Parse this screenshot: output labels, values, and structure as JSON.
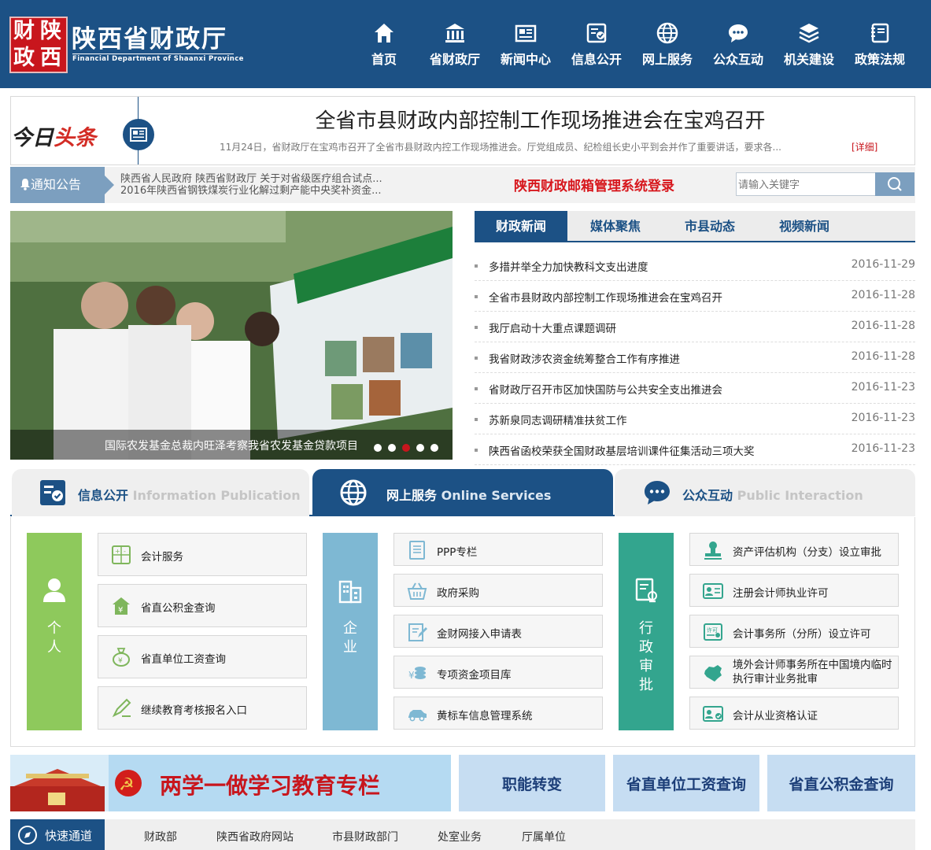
{
  "logo": {
    "seal_chars": [
      "财",
      "陕",
      "政",
      "西"
    ],
    "title": "陕西省财政厅",
    "subtitle": "Financial Department of Shaanxi Province"
  },
  "nav": [
    {
      "label": "首页",
      "icon": "home-icon"
    },
    {
      "label": "省财政厅",
      "icon": "building-icon"
    },
    {
      "label": "新闻中心",
      "icon": "newspaper-icon"
    },
    {
      "label": "信息公开",
      "icon": "document-check-icon"
    },
    {
      "label": "网上服务",
      "icon": "globe-icon"
    },
    {
      "label": "公众互动",
      "icon": "chat-icon"
    },
    {
      "label": "机关建设",
      "icon": "layers-icon"
    },
    {
      "label": "政策法规",
      "icon": "book-icon"
    }
  ],
  "headline": {
    "label_a": "今日",
    "label_b": "头条",
    "title": "全省市县财政内部控制工作现场推进会在宝鸡召开",
    "summary": "11月24日，省财政厅在宝鸡市召开了全省市县财政内控工作现场推进会。厅党组成员、纪检组长史小平到会并作了重要讲话，要求各...",
    "more": "[详细]"
  },
  "notice": {
    "label": "通知公告",
    "items": [
      "陕西省人民政府 陕西省财政厅 关于对省级医疗组合试点...",
      "2016年陕西省钢铁煤炭行业化解过剩产能中央奖补资金..."
    ]
  },
  "mail_login": "陕西财政邮箱管理系统登录",
  "search": {
    "placeholder": "请输入关键字"
  },
  "slider": {
    "caption": "国际农发基金总裁内旺泽考察我省农发基金贷款项目",
    "dots": 5,
    "active_dot": 3
  },
  "news_tabs": [
    "财政新闻",
    "媒体聚焦",
    "市县动态",
    "视频新闻"
  ],
  "news_active_tab": 0,
  "news": [
    {
      "title": "多措并举全力加快教科文支出进度",
      "date": "2016-11-29"
    },
    {
      "title": "全省市县财政内部控制工作现场推进会在宝鸡召开",
      "date": "2016-11-28"
    },
    {
      "title": "我厅启动十大重点课题调研",
      "date": "2016-11-28"
    },
    {
      "title": "我省财政涉农资金统筹整合工作有序推进",
      "date": "2016-11-28"
    },
    {
      "title": "省财政厅召开市区加快国防与公共安全支出推进会",
      "date": "2016-11-23"
    },
    {
      "title": "苏新泉同志调研精准扶贫工作",
      "date": "2016-11-23"
    },
    {
      "title": "陕西省函校荣获全国财政基层培训课件征集活动三项大奖",
      "date": "2016-11-23"
    }
  ],
  "svc_tabs": [
    {
      "cn": "信息公开",
      "en": "Information Publication"
    },
    {
      "cn": "网上服务",
      "en": "Online Services"
    },
    {
      "cn": "公众互动",
      "en": "Public Interaction"
    }
  ],
  "svc_active_tab": 1,
  "categories": [
    {
      "chars": [
        "个",
        "人"
      ],
      "color": "#8ec95c"
    },
    {
      "chars": [
        "企",
        "业"
      ],
      "color": "#7eb8d3"
    },
    {
      "chars": [
        "行",
        "政",
        "审",
        "批"
      ],
      "color": "#33a58e"
    }
  ],
  "personal": [
    "会计服务",
    "省直公积金查询",
    "省直单位工资查询",
    "继续教育考核报名入口"
  ],
  "enterprise": [
    "PPP专栏",
    "政府采购",
    "金财网接入申请表",
    "专项资金项目库",
    "黄标车信息管理系统"
  ],
  "admin": [
    "资产评估机构（分支）设立审批",
    "注册会计师执业许可",
    "会计事务所（分所）设立许可",
    "境外会计师事务所在中国境内临时执行审计业务批审",
    "会计从业资格认证"
  ],
  "banners": {
    "study": "两学一做学习教育专栏",
    "b1": "职能转变",
    "b2": "省直单位工资查询",
    "b3": "省直公积金查询"
  },
  "quick": {
    "label": "快速通道",
    "links": [
      "财政部",
      "陕西省政府网站",
      "市县财政部门",
      "处室业务",
      "厅属单位"
    ]
  },
  "colors": {
    "brand": "#1c5185",
    "accent_red": "#c8161d",
    "personal": "#8ec95c",
    "enterprise": "#7eb8d3",
    "admin": "#33a58e"
  }
}
